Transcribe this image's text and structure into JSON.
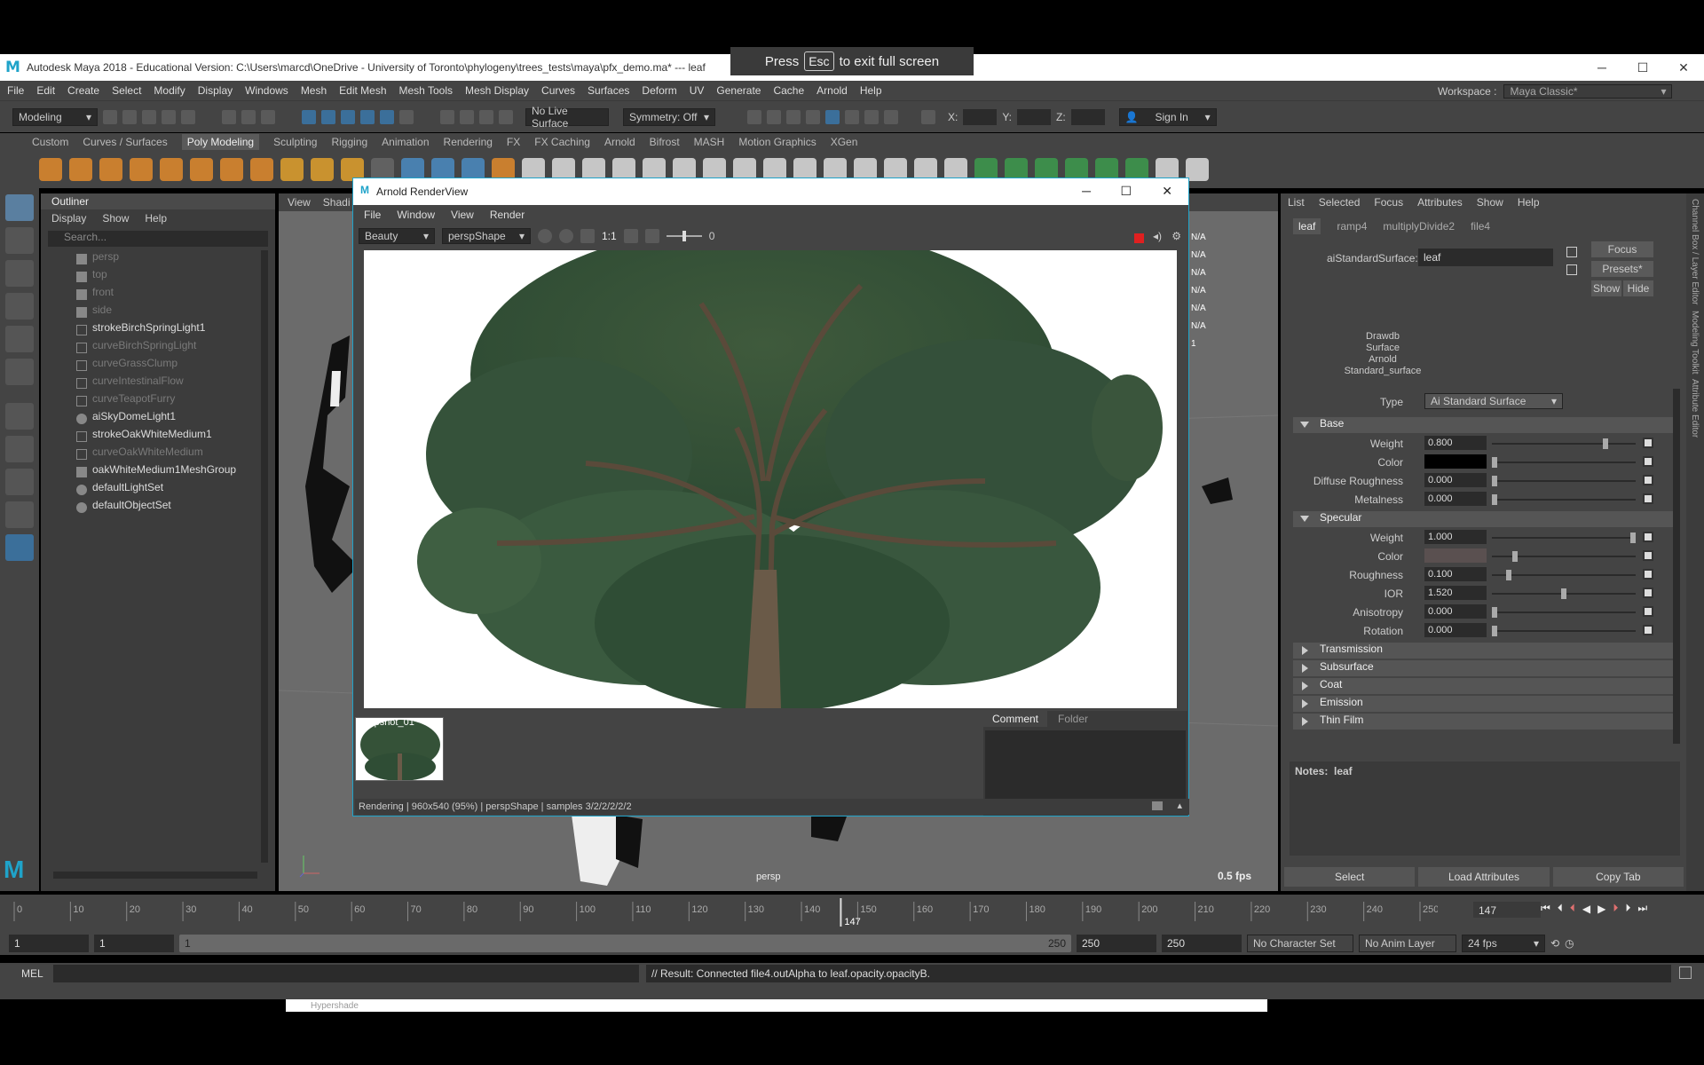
{
  "fullscreen_notice": {
    "press": "Press",
    "key": "Esc",
    "rest": "to exit full screen"
  },
  "window": {
    "title": "Autodesk Maya 2018 - Educational Version: C:\\Users\\marcd\\OneDrive - University of Toronto\\phylogeny\\trees_tests\\maya\\pfx_demo.ma*   ---   leaf"
  },
  "menubar": [
    "File",
    "Edit",
    "Create",
    "Select",
    "Modify",
    "Display",
    "Windows",
    "Mesh",
    "Edit Mesh",
    "Mesh Tools",
    "Mesh Display",
    "Curves",
    "Surfaces",
    "Deform",
    "UV",
    "Generate",
    "Cache",
    "Arnold",
    "Help"
  ],
  "toolbar": {
    "mode": "Modeling",
    "live_surface": "No Live Surface",
    "symmetry": "Symmetry: Off",
    "x": "X:",
    "y": "Y:",
    "z": "Z:",
    "sign_in": "Sign In",
    "workspace_label": "Workspace :",
    "workspace": "Maya Classic*"
  },
  "shelf_tabs": [
    "Custom",
    "Curves / Surfaces",
    "Poly Modeling",
    "Sculpting",
    "Rigging",
    "Animation",
    "Rendering",
    "FX",
    "FX Caching",
    "Arnold",
    "Bifrost",
    "MASH",
    "Motion Graphics",
    "XGen"
  ],
  "outliner": {
    "title": "Outliner",
    "menu": [
      "Display",
      "Show",
      "Help"
    ],
    "search_placeholder": "Search...",
    "items": [
      {
        "label": "persp",
        "dim": true
      },
      {
        "label": "top",
        "dim": true
      },
      {
        "label": "front",
        "dim": true
      },
      {
        "label": "side",
        "dim": true
      },
      {
        "label": "strokeBirchSpringLight1",
        "dim": false
      },
      {
        "label": "curveBirchSpringLight",
        "dim": true
      },
      {
        "label": "curveGrassClump",
        "dim": true
      },
      {
        "label": "curveIntestinalFlow",
        "dim": true
      },
      {
        "label": "curveTeapotFurry",
        "dim": true
      },
      {
        "label": "aiSkyDomeLight1",
        "dim": false
      },
      {
        "label": "strokeOakWhiteMedium1",
        "dim": false
      },
      {
        "label": "curveOakWhiteMedium",
        "dim": true
      },
      {
        "label": "oakWhiteMedium1MeshGroup",
        "dim": false
      },
      {
        "label": "defaultLightSet",
        "dim": false
      },
      {
        "label": "defaultObjectSet",
        "dim": false
      }
    ]
  },
  "viewport": {
    "menu": [
      "View",
      "Shadi"
    ],
    "camera": "persp",
    "fps": "0.5 fps",
    "na_labels": [
      "N/A",
      "N/A",
      "N/A",
      "N/A",
      "N/A",
      "N/A",
      "1"
    ]
  },
  "render_view": {
    "title": "Arnold RenderView",
    "menu": [
      "File",
      "Window",
      "View",
      "Render"
    ],
    "aov": "Beauty",
    "camera": "perspShape",
    "ratio": "1:1",
    "exposure": "0",
    "snapshot": "Snapshot_01",
    "tabs": [
      "Comment",
      "Folder"
    ],
    "status": "Rendering | 960x540 (95%) | perspShape  | samples 3/2/2/2/2/2"
  },
  "attribute_editor": {
    "menu": [
      "List",
      "Selected",
      "Focus",
      "Attributes",
      "Show",
      "Help"
    ],
    "tabs": [
      "leaf",
      "ramp4",
      "multiplyDivide2",
      "file4"
    ],
    "node_type_label": "aiStandardSurface:",
    "node_name": "leaf",
    "buttons": {
      "focus": "Focus",
      "presets": "Presets*",
      "show": "Show",
      "hide": "Hide"
    },
    "classification": [
      "Drawdb",
      "Surface",
      "Arnold",
      "Standard_surface"
    ],
    "type_label": "Type",
    "type_value": "Ai Standard Surface",
    "base": {
      "title": "Base",
      "rows": [
        {
          "label": "Weight",
          "value": "0.800",
          "pos": 0.8
        },
        {
          "label": "Color",
          "value": "",
          "pos": 0,
          "swatch": "#000000"
        },
        {
          "label": "Diffuse Roughness",
          "value": "0.000",
          "pos": 0
        },
        {
          "label": "Metalness",
          "value": "0.000",
          "pos": 0
        }
      ]
    },
    "specular": {
      "title": "Specular",
      "rows": [
        {
          "label": "Weight",
          "value": "1.000",
          "pos": 1.0
        },
        {
          "label": "Color",
          "value": "",
          "pos": 0.15,
          "swatch": "#5a5050"
        },
        {
          "label": "Roughness",
          "value": "0.100",
          "pos": 0.1
        },
        {
          "label": "IOR",
          "value": "1.520",
          "pos": 0.5
        },
        {
          "label": "Anisotropy",
          "value": "0.000",
          "pos": 0
        },
        {
          "label": "Rotation",
          "value": "0.000",
          "pos": 0
        }
      ]
    },
    "collapsed": [
      "Transmission",
      "Subsurface",
      "Coat",
      "Emission",
      "Thin Film"
    ],
    "notes_label": "Notes:",
    "notes_value": "leaf",
    "bottom_buttons": [
      "Select",
      "Load Attributes",
      "Copy Tab"
    ]
  },
  "timeline": {
    "ticks": [
      "0",
      "10",
      "20",
      "30",
      "40",
      "50",
      "60",
      "70",
      "80",
      "90",
      "100",
      "110",
      "120",
      "130",
      "140",
      "150",
      "160",
      "170",
      "180",
      "190",
      "200",
      "210",
      "220",
      "230",
      "240",
      "250"
    ],
    "current_marker": "147",
    "current_field": "147"
  },
  "range": {
    "start": "1",
    "start2": "1",
    "range_start": "1",
    "range_end": "250",
    "end": "250",
    "end2": "250",
    "character_set": "No Character Set",
    "anim_layer": "No Anim Layer",
    "fps": "24 fps"
  },
  "command": {
    "lang": "MEL",
    "result": "// Result: Connected file4.outAlpha to leaf.opacity.opacityB."
  },
  "right_tabs": [
    "Channel Box / Layer Editor",
    "Modeling Toolkit",
    "Attribute Editor"
  ],
  "bottom_window": {
    "title": "Hypershade"
  }
}
